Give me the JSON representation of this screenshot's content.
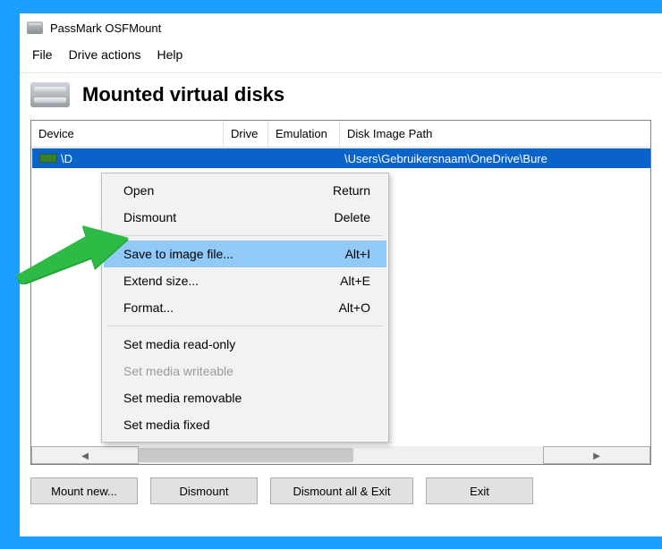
{
  "window": {
    "title": "PassMark OSFMount"
  },
  "menubar": {
    "file": "File",
    "drive_actions": "Drive actions",
    "help": "Help"
  },
  "section": {
    "title": "Mounted virtual disks"
  },
  "table": {
    "headers": {
      "device": "Device",
      "drive": "Drive",
      "emulation": "Emulation",
      "path": "Disk Image Path"
    },
    "rows": [
      {
        "device": "\\D",
        "drive": "",
        "emulation": "",
        "path": "\\Users\\Gebruikersnaam\\OneDrive\\Bure"
      }
    ]
  },
  "context_menu": {
    "items": [
      {
        "label": "Open",
        "accel": "Return",
        "disabled": false
      },
      {
        "label": "Dismount",
        "accel": "Delete",
        "disabled": false
      },
      {
        "sep": true
      },
      {
        "label": "Save to image file...",
        "accel": "Alt+I",
        "disabled": false,
        "highlight": true
      },
      {
        "label": "Extend size...",
        "accel": "Alt+E",
        "disabled": false
      },
      {
        "label": "Format...",
        "accel": "Alt+O",
        "disabled": false
      },
      {
        "sep": true
      },
      {
        "label": "Set media read-only",
        "accel": "",
        "disabled": false
      },
      {
        "label": "Set media writeable",
        "accel": "",
        "disabled": true
      },
      {
        "label": "Set media removable",
        "accel": "",
        "disabled": false
      },
      {
        "label": "Set media fixed",
        "accel": "",
        "disabled": false
      }
    ]
  },
  "footer": {
    "mount_new": "Mount new...",
    "dismount": "Dismount",
    "dismount_all_exit": "Dismount all & Exit",
    "exit": "Exit"
  },
  "scroll": {
    "left_glyph": "◄",
    "right_glyph": "►"
  }
}
